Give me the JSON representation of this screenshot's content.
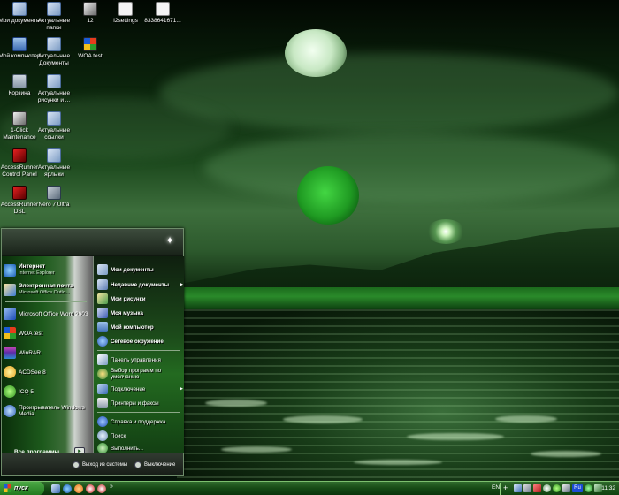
{
  "desktop": {
    "icons": [
      {
        "label": "Мои документы",
        "icon": "folder-icon"
      },
      {
        "label": "Актуальные папки",
        "icon": "folder-icon"
      },
      {
        "label": "12",
        "icon": "document-icon"
      },
      {
        "label": "I2settings",
        "icon": "document-icon"
      },
      {
        "label": "8338641671...",
        "icon": "document-icon"
      },
      {
        "label": "Мой компьютер",
        "icon": "computer-icon"
      },
      {
        "label": "Актуальные Документы",
        "icon": "folder-icon"
      },
      {
        "label": "WOA test",
        "icon": "windows-icon"
      },
      {
        "label": "Корзина",
        "icon": "recycle-bin-icon"
      },
      {
        "label": "Актуальные рисунки и ...",
        "icon": "folder-icon"
      },
      {
        "label": "1-Click Maintenance",
        "icon": "tools-icon"
      },
      {
        "label": "Актуальные ссылки",
        "icon": "folder-icon"
      },
      {
        "label": "AccessRunner Control Panel",
        "icon": "modem-icon"
      },
      {
        "label": "Актуальные ярлыки",
        "icon": "folder-icon"
      },
      {
        "label": "AccessRunner DSL",
        "icon": "modem-icon"
      },
      {
        "label": "Nero 7 Ultra",
        "icon": "nero-icon"
      }
    ]
  },
  "start_menu": {
    "pinned": [
      {
        "title": "Интернет",
        "subtitle": "Internet Explorer",
        "icon": "internet-explorer-icon"
      },
      {
        "title": "Электронная почта",
        "subtitle": "Microsoft Office Outlo...",
        "icon": "email-icon"
      }
    ],
    "recent": [
      {
        "title": "Microsoft Office Word 2003",
        "icon": "word-icon"
      },
      {
        "title": "WOA test",
        "icon": "windows-icon"
      },
      {
        "title": "WinRAR",
        "icon": "winrar-icon"
      },
      {
        "title": "ACDSee 8",
        "icon": "acdsee-icon"
      },
      {
        "title": "ICQ 5",
        "icon": "icq-icon"
      },
      {
        "title": "Проигрыватель Windows Media",
        "icon": "media-player-icon"
      }
    ],
    "all_programs": "Все программы",
    "right": [
      {
        "title": "Мои документы",
        "bold": true,
        "arrow": false,
        "icon": "folder-icon"
      },
      {
        "title": "Недавние документы",
        "bold": true,
        "arrow": true,
        "icon": "recent-documents-icon"
      },
      {
        "title": "Мои рисунки",
        "bold": true,
        "arrow": false,
        "icon": "pictures-icon"
      },
      {
        "title": "Моя музыка",
        "bold": true,
        "arrow": false,
        "icon": "music-icon"
      },
      {
        "title": "Мой компьютер",
        "bold": true,
        "arrow": false,
        "icon": "computer-icon"
      },
      {
        "title": "Сетевое окружение",
        "bold": true,
        "arrow": false,
        "icon": "network-icon"
      },
      {
        "title": "Панель управления",
        "bold": false,
        "arrow": false,
        "icon": "control-panel-icon"
      },
      {
        "title": "Выбор программ по умолчанию",
        "bold": false,
        "arrow": false,
        "icon": "default-programs-icon"
      },
      {
        "title": "Подключение",
        "bold": false,
        "arrow": true,
        "icon": "connection-icon"
      },
      {
        "title": "Принтеры и факсы",
        "bold": false,
        "arrow": false,
        "icon": "printer-icon"
      },
      {
        "title": "Справка и поддержка",
        "bold": false,
        "arrow": false,
        "icon": "help-icon"
      },
      {
        "title": "Поиск",
        "bold": false,
        "arrow": false,
        "icon": "search-icon"
      },
      {
        "title": "Выполнить...",
        "bold": false,
        "arrow": false,
        "icon": "run-icon"
      }
    ],
    "logoff": "Выход из системы",
    "shutdown": "Выключение"
  },
  "taskbar": {
    "start_label": "пуск",
    "quick_launch_more": "»",
    "language": "EN",
    "tray_language": "Ru",
    "clock": "11:32"
  },
  "colors": {
    "accent": "#2c8a2a",
    "taskbar": "#164a15",
    "menu_border": "#6e8c6a"
  }
}
